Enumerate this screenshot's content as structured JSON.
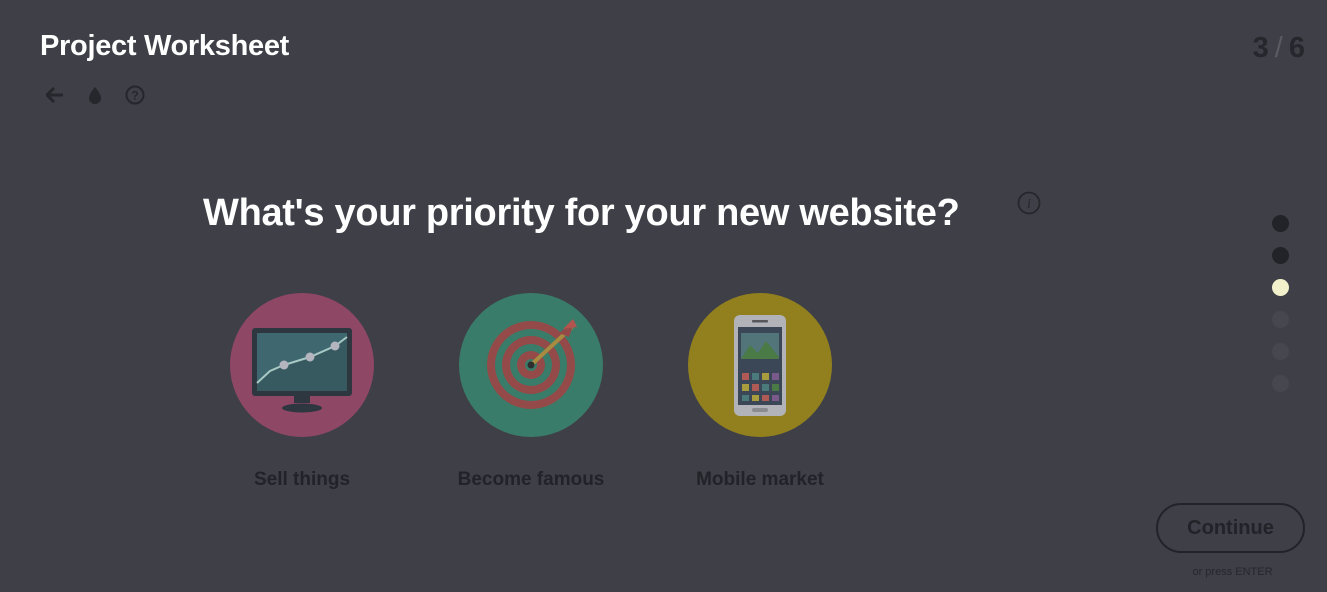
{
  "header": {
    "title": "Project Worksheet",
    "icons": [
      "back-arrow-icon",
      "droplet-icon",
      "help-circle-icon"
    ],
    "progress": {
      "current": "3",
      "separator": "/",
      "total": "6"
    }
  },
  "question": {
    "text": "What's your priority for your new website?",
    "info_icon": "info-icon"
  },
  "options": [
    {
      "label": "Sell things",
      "color": "#8f4766",
      "icon": "monitor-chart-icon"
    },
    {
      "label": "Become famous",
      "color": "#3a7c6a",
      "icon": "target-dart-icon"
    },
    {
      "label": "Mobile market",
      "color": "#92801f",
      "icon": "smartphone-icon"
    }
  ],
  "step_dots": [
    {
      "state": "done",
      "color": "#222329"
    },
    {
      "state": "done",
      "color": "#222329"
    },
    {
      "state": "active",
      "color": "#f3f1cc"
    },
    {
      "state": "upcoming",
      "color": "#46474f"
    },
    {
      "state": "upcoming",
      "color": "#46474f"
    },
    {
      "state": "upcoming",
      "color": "#46474f"
    }
  ],
  "footer": {
    "continue_label": "Continue",
    "hint": "or press ENTER"
  },
  "colors": {
    "background": "#3e3f47",
    "dark_text": "#222329"
  }
}
